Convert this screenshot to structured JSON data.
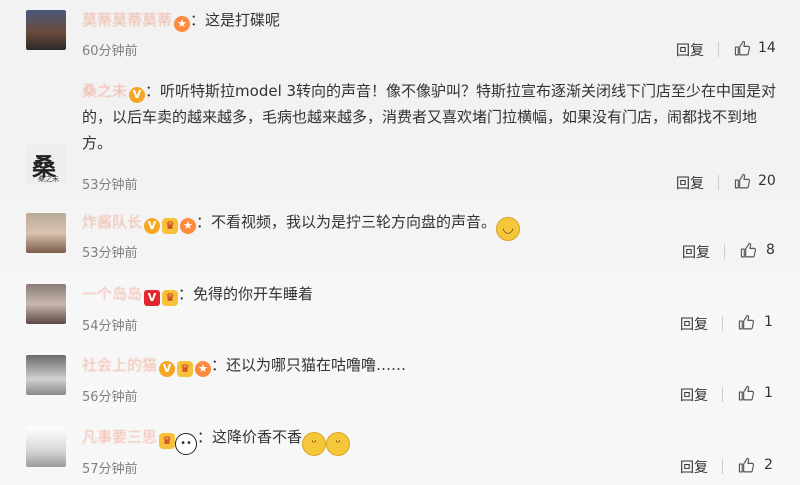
{
  "comments": [
    {
      "username": "莫蒂莫蒂莫蒂",
      "text": "这是打碟呢",
      "time": "60分钟前",
      "reply_label": "回复",
      "likes": "14",
      "avatar_icon": "user-avatar"
    },
    {
      "username": "桑之未",
      "text": "听听特斯拉model 3转向的声音！像不像驴叫？特斯拉宣布逐渐关闭线下门店至少在中国是对的，以后车卖的越来越多，毛病也越来越多，消费者又喜欢堵门拉横幅，如果没有门店，闹都找不到地方。",
      "time": "53分钟前",
      "reply_label": "回复",
      "likes": "20",
      "avatar_text": "桑",
      "avatar_subtext": "桑之未"
    },
    {
      "username": "炸酱队长",
      "text": "不看视频，我以为是拧三轮方向盘的声音。",
      "time": "53分钟前",
      "reply_label": "回复",
      "likes": "8"
    },
    {
      "username": "一个岛岛",
      "text": "免得的你开车睡着",
      "time": "54分钟前",
      "reply_label": "回复",
      "likes": "1"
    },
    {
      "username": "社会上的猫",
      "text": "还以为哪只猫在咕噜噜……",
      "time": "56分钟前",
      "reply_label": "回复",
      "likes": "1"
    },
    {
      "username": "凡事要三思",
      "text": "这降价香不香",
      "time": "57分钟前",
      "reply_label": "回复",
      "likes": "2"
    }
  ],
  "colon": "：",
  "icons": {
    "like": "thumbs-up-icon",
    "vip": "vip-badge-icon",
    "emoji_smile": "smile-emoji-icon",
    "emoji_doge": "doge-emoji-icon",
    "emoji_panda": "panda-emoji-icon"
  },
  "colors": {
    "username": "#eb7350",
    "text": "#333333",
    "time": "#808080",
    "background": "#f2f2f2"
  }
}
